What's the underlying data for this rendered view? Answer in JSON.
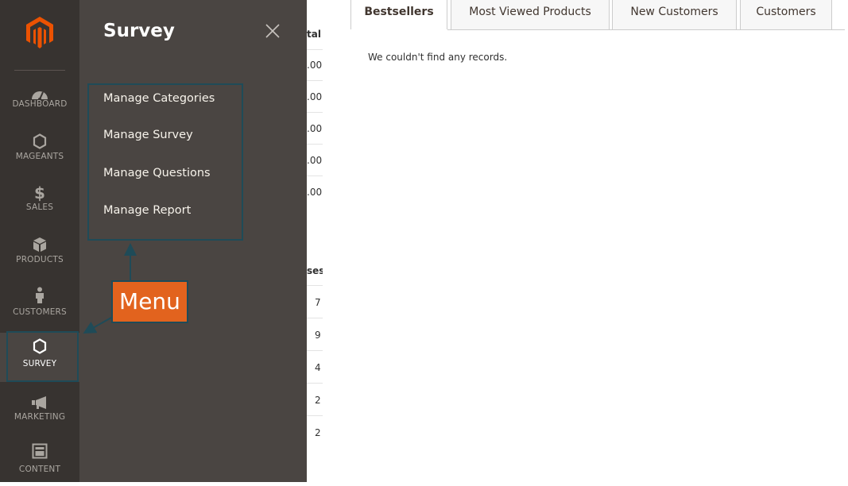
{
  "nav": {
    "items": [
      {
        "label": "DASHBOARD",
        "icon": "dashboard-gauge-icon"
      },
      {
        "label": "MAGEANTS",
        "icon": "hexagon-icon"
      },
      {
        "label": "SALES",
        "icon": "dollar-icon"
      },
      {
        "label": "PRODUCTS",
        "icon": "box-icon"
      },
      {
        "label": "CUSTOMERS",
        "icon": "person-icon"
      },
      {
        "label": "SURVEY",
        "icon": "hexagon-icon"
      },
      {
        "label": "MARKETING",
        "icon": "megaphone-icon"
      },
      {
        "label": "CONTENT",
        "icon": "layout-icon"
      }
    ],
    "active": "SURVEY"
  },
  "flyout": {
    "title": "Survey",
    "items": [
      {
        "label": "Manage Categories"
      },
      {
        "label": "Manage Survey"
      },
      {
        "label": "Manage Questions"
      },
      {
        "label": "Manage Report"
      }
    ]
  },
  "annotation": {
    "callout": "Menu",
    "callout_color": "#e2631e",
    "outline_color": "#1f4b58"
  },
  "background_column": {
    "header_top": "tal",
    "values_top": [
      ".00",
      ".00",
      ".00",
      ".00",
      ".00"
    ],
    "header_bottom": "ses",
    "values_bottom": [
      "7",
      "9",
      "4",
      "2",
      "2"
    ]
  },
  "tabs": [
    {
      "label": "Bestsellers",
      "active": true
    },
    {
      "label": "Most Viewed Products",
      "active": false
    },
    {
      "label": "New Customers",
      "active": false
    },
    {
      "label": "Customers",
      "active": false
    }
  ],
  "tab_content": {
    "empty_message": "We couldn't find any records."
  },
  "colors": {
    "nav_bg": "#373330",
    "flyout_bg": "#4a4542",
    "logo_orange": "#eb5202"
  }
}
